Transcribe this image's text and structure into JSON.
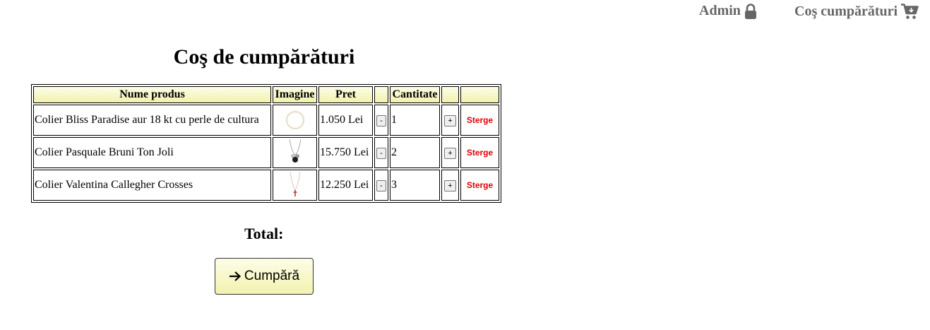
{
  "nav": {
    "admin_label": "Admin",
    "cart_label": "Coş cumpărături"
  },
  "page_title": "Coş de cumpărături",
  "table": {
    "headers": [
      "Nume produs",
      "Imagine",
      "Pret",
      "",
      "Cantitate",
      "",
      ""
    ],
    "rows": [
      {
        "name": "Colier Bliss Paradise aur 18 kt cu perle de cultura",
        "price": "1.050 Lei",
        "qty": "1",
        "minus": "-",
        "plus": "+",
        "delete": "Sterge"
      },
      {
        "name": "Colier Pasquale Bruni Ton Joli",
        "price": "15.750 Lei",
        "qty": "2",
        "minus": "-",
        "plus": "+",
        "delete": "Sterge"
      },
      {
        "name": "Colier Valentina Callegher Crosses",
        "price": "12.250 Lei",
        "qty": "3",
        "minus": "-",
        "plus": "+",
        "delete": "Sterge"
      }
    ]
  },
  "total_label": "Total:",
  "buy_button_label": "Cumpără",
  "colors": {
    "nav_text": "#666666",
    "delete_link": "#e00000",
    "header_bg": "#f2f2ae"
  },
  "icons": {
    "admin": "lock-icon",
    "cart": "shopping-cart-icon",
    "buy": "arrow-right-icon"
  }
}
